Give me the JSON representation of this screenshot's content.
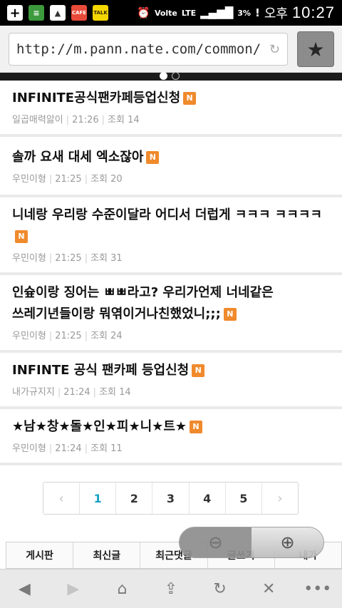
{
  "status_bar": {
    "time": "10:27",
    "ampm": "오후",
    "battery": "3%",
    "network": "LTE",
    "volte": "Volte",
    "icons": [
      "plus-icon",
      "sheet-icon",
      "gallery-icon",
      "cafe-icon",
      "talk-icon",
      "alarm-icon",
      "volte-icon",
      "lte-icon",
      "signal-icon",
      "battery-icon",
      "alert-icon"
    ],
    "cafe_label": "CAFE",
    "talk_label": "TALK"
  },
  "browser": {
    "url": "http://m.pann.nate.com/common/",
    "star_icon": "star-icon",
    "reload_icon": "reload-icon"
  },
  "posts": [
    {
      "title": "INFINITE공식팬카페등업신청",
      "badge": "N",
      "author": "일곱매력앓이",
      "time": "21:26",
      "views": "조회 14"
    },
    {
      "title": "솔까 요새 대세 엑소잖아",
      "badge": "N",
      "author": "우민이형",
      "time": "21:25",
      "views": "조회 20"
    },
    {
      "title": "니네랑 우리랑 수준이달라 어디서 더럽게 ㅋㅋㅋ ㅋㅋㅋㅋ",
      "badge": "N",
      "author": "우민이형",
      "time": "21:25",
      "views": "조회 31"
    },
    {
      "title": "인슢이랑 징어는 ㅃㅃ라고? 우리가언제 너네같은 쓰레기년들이랑 뭐엮이거나친했었니;;;",
      "badge": "N",
      "author": "우민이형",
      "time": "21:25",
      "views": "조회 24"
    },
    {
      "title": "INFINTE 공식 팬카페 등업신청",
      "badge": "N",
      "author": "내가규지지",
      "time": "21:24",
      "views": "조회 14"
    },
    {
      "title": "★남★창★돌★인★피★니★트★",
      "badge": "N",
      "author": "우민이형",
      "time": "21:24",
      "views": "조회 11"
    }
  ],
  "pagination": {
    "prev": "‹",
    "next": "›",
    "pages": [
      "1",
      "2",
      "3",
      "4",
      "5"
    ],
    "current": "1"
  },
  "bottom_tabs": [
    "게시판",
    "최신글",
    "최근댓글",
    "글쓰기",
    "내가"
  ],
  "zoom": {
    "out_icon": "zoom-out-icon",
    "in_icon": "zoom-in-icon"
  },
  "nav": {
    "back": "◀",
    "forward": "▶",
    "home": "⌂",
    "share": "⇪",
    "refresh": "↻",
    "close": "✕",
    "more": "•••"
  }
}
